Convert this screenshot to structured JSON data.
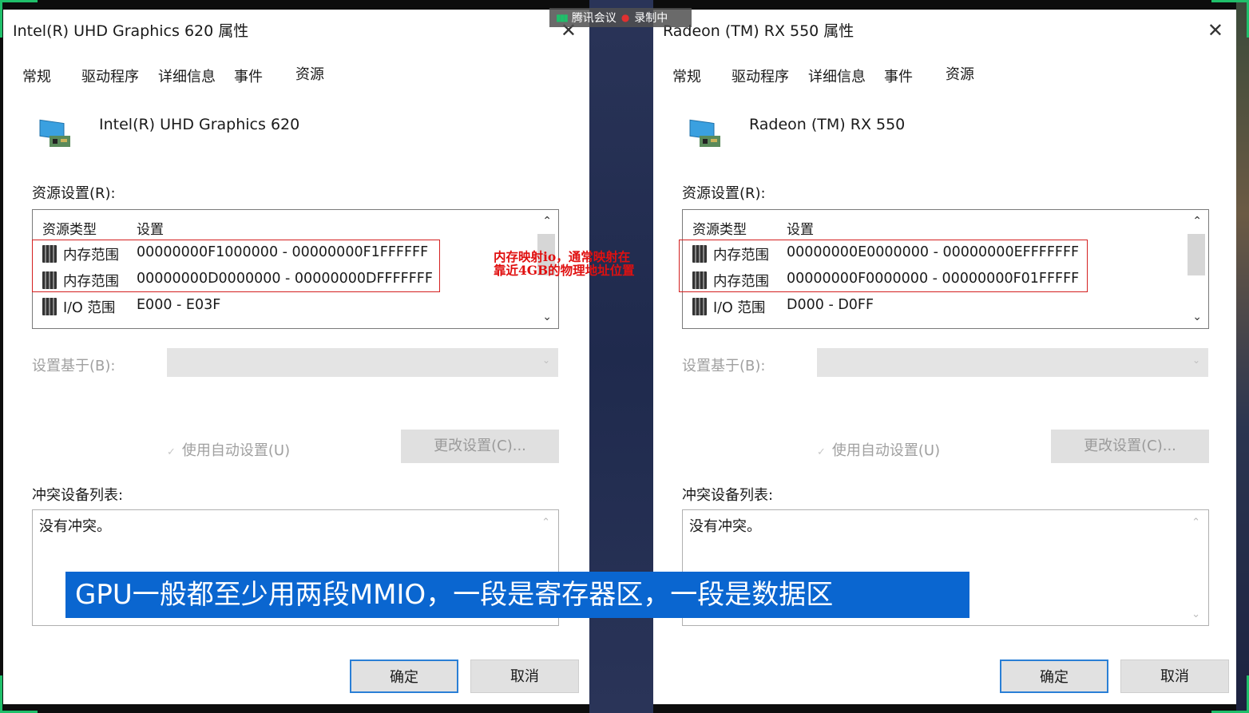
{
  "meeting_bar": {
    "app": "腾讯会议",
    "recording": "录制中"
  },
  "annotation": {
    "line1": "内存映射io，通常映射在",
    "line2": "靠近4GB的物理地址位置"
  },
  "caption": "GPU一般都至少用两段MMIO，一段是寄存器区，一段是数据区",
  "common": {
    "tabs": [
      "常规",
      "驱动程序",
      "详细信息",
      "事件",
      "资源"
    ],
    "close": "✕",
    "resource_settings_label": "资源设置(R):",
    "col_type": "资源类型",
    "col_setting": "设置",
    "setting_based_on_label": "设置基于(B):",
    "auto_settings_label": "使用自动设置(U)",
    "change_settings_button": "更改设置(C)...",
    "conflict_label": "冲突设备列表:",
    "conflict_text": "没有冲突。",
    "ok_button": "确定",
    "cancel_button": "取消"
  },
  "dialogs": {
    "left": {
      "title": "Intel(R) UHD Graphics 620 属性",
      "device_name": "Intel(R) UHD Graphics 620",
      "resources": [
        {
          "type": "内存范围",
          "range": "00000000F1000000 - 00000000F1FFFFFF"
        },
        {
          "type": "内存范围",
          "range": "00000000D0000000 - 00000000DFFFFFFF"
        },
        {
          "type": "I/O 范围",
          "range": "E000 - E03F"
        }
      ]
    },
    "right": {
      "title": "Radeon (TM) RX 550 属性",
      "device_name": "Radeon (TM) RX 550",
      "resources": [
        {
          "type": "内存范围",
          "range": "00000000E0000000 - 00000000EFFFFFFF"
        },
        {
          "type": "内存范围",
          "range": "00000000F0000000 - 00000000F01FFFFF"
        },
        {
          "type": "I/O 范围",
          "range": "D000 - D0FF"
        }
      ]
    }
  },
  "colors": {
    "accent": "#2a7fd6",
    "highlight": "#d42020",
    "caption_bg": "#0a66d0",
    "corner": "#1fbf6a"
  }
}
